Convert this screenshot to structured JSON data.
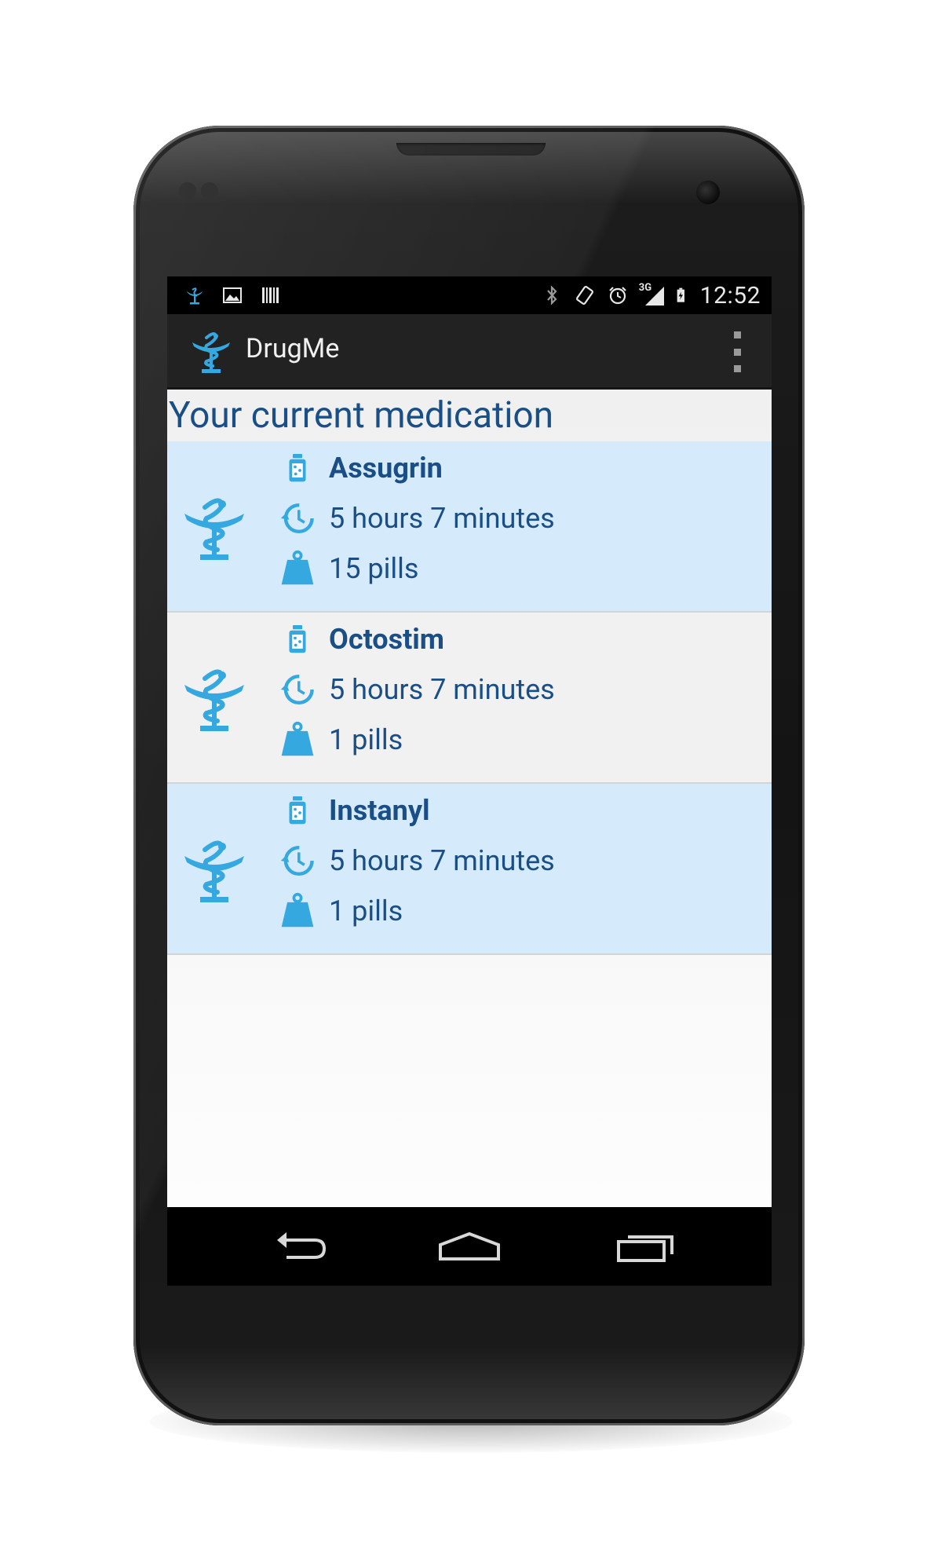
{
  "status_bar": {
    "time": "12:52",
    "network_label": "3G",
    "left_icons": [
      "app-notification-icon",
      "image-icon",
      "barcode-icon"
    ],
    "right_icons": [
      "bluetooth-icon",
      "rotate-icon",
      "alarm-icon",
      "signal-icon",
      "battery-icon"
    ]
  },
  "app_bar": {
    "title": "DrugMe",
    "logo_icon": "caduceus-bowl-icon",
    "menu_icon": "overflow-menu-icon"
  },
  "main": {
    "heading": "Your current medication",
    "medications": [
      {
        "name": "Assugrin",
        "time": "5 hours 7 minutes",
        "quantity": "15 pills",
        "highlighted": true
      },
      {
        "name": "Octostim",
        "time": "5 hours 7 minutes",
        "quantity": "1 pills",
        "highlighted": false
      },
      {
        "name": "Instanyl",
        "time": "5 hours 7 minutes",
        "quantity": "1 pills",
        "highlighted": true
      }
    ]
  },
  "nav_bar": {
    "buttons": [
      "back-icon",
      "home-icon",
      "recent-apps-icon"
    ]
  },
  "colors": {
    "accent_blue": "#35a8e0",
    "text_blue": "#1a4e86",
    "highlight_row": "#d5ebfb",
    "plain_row": "#f1f1f1"
  }
}
